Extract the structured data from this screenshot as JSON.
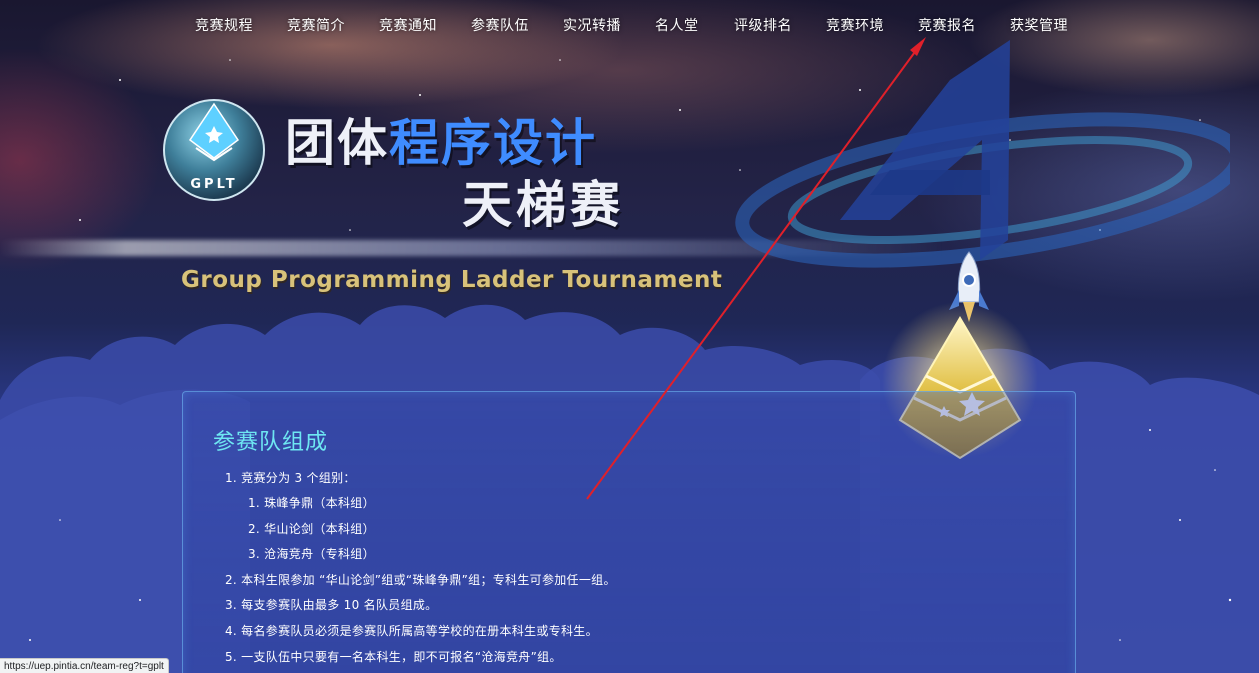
{
  "nav": {
    "items": [
      {
        "label": "竞赛规程"
      },
      {
        "label": "竞赛简介"
      },
      {
        "label": "竞赛通知"
      },
      {
        "label": "参赛队伍"
      },
      {
        "label": "实况转播"
      },
      {
        "label": "名人堂"
      },
      {
        "label": "评级排名"
      },
      {
        "label": "竞赛环境"
      },
      {
        "label": "竞赛报名"
      },
      {
        "label": "获奖管理"
      }
    ]
  },
  "hero": {
    "badge_text": "GPLT",
    "title_part1": "团体",
    "title_part2": "程序设计",
    "title_line2": "天梯赛",
    "title_en": "Group Programming Ladder Tournament"
  },
  "panel": {
    "title": "参赛队组成",
    "rules": [
      {
        "text": "1. 竞赛分为 3 个组别："
      },
      {
        "text": "1. 珠峰争鼎（本科组）"
      },
      {
        "text": "2. 华山论剑（本科组）"
      },
      {
        "text": "3. 沧海竞舟（专科组）"
      },
      {
        "text": "2. 本科生限参加 “华山论剑”组或“珠峰争鼎”组；专科生可参加任一组。"
      },
      {
        "text": "3. 每支参赛队由最多 10 名队员组成。"
      },
      {
        "text": "4. 每名参赛队员必须是参赛队所属高等学校的在册本科生或专科生。"
      },
      {
        "text": "5. 一支队伍中只要有一名本科生，即不可报名“沧海竞舟”组。"
      }
    ]
  },
  "status_bar": {
    "url": "https://uep.pintia.cn/team-reg?t=gplt"
  },
  "colors": {
    "panel_title": "#6ee7f2",
    "title_blue": "#3f8cff",
    "title_en_gold": "#d8c27a",
    "annotation_arrow": "#e0202a"
  },
  "icons": {
    "logo": "gplt-globe-badge-icon",
    "emblem": "stylized-a-emblem-icon",
    "rocket": "rocket-icon",
    "trophy": "gold-pyramid-icon"
  }
}
